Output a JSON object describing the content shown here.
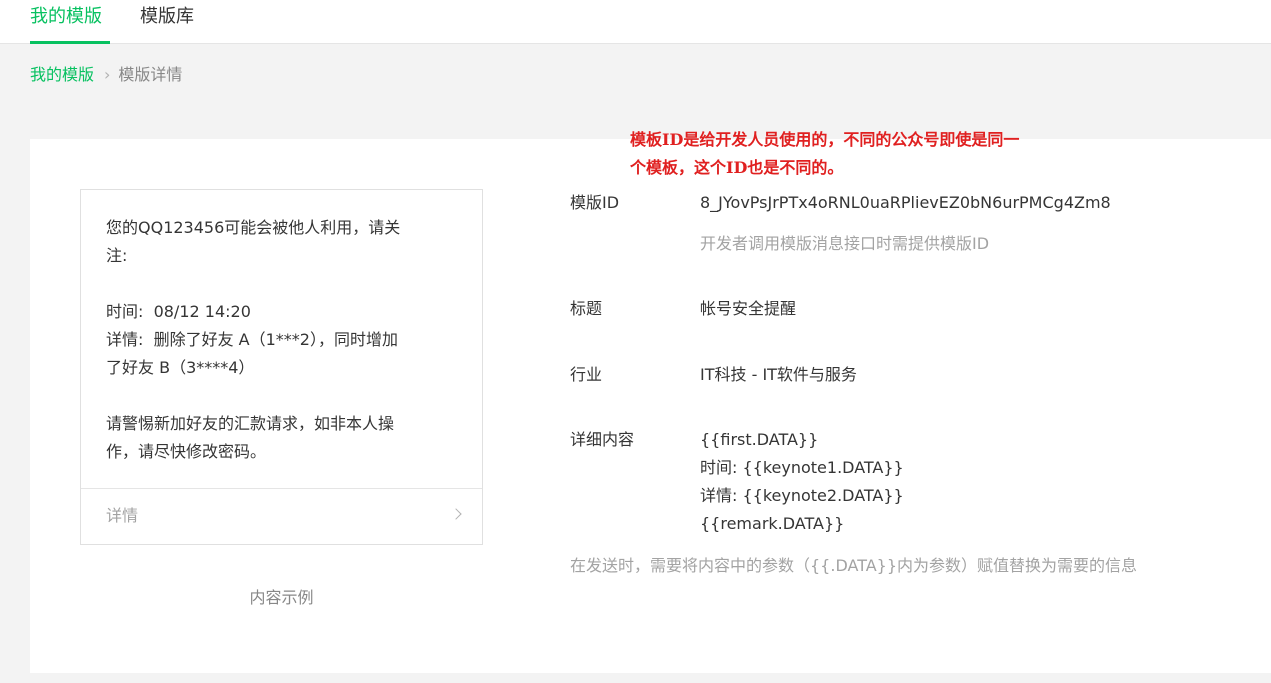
{
  "tabs": {
    "my_templates": "我的模版",
    "library": "模版库"
  },
  "breadcrumb": {
    "root": "我的模版",
    "separator": "›",
    "current": "模版详情"
  },
  "annotation": {
    "line1": "模板ID是给开发人员使用的，不同的公众号即使是同一",
    "line2": "个模板，这个ID也是不同的。"
  },
  "preview": {
    "lines": [
      "您的QQ123456可能会被他人利用，请关",
      "注:",
      "",
      "时间:  08/12 14:20",
      "详情:  删除了好友 A（1***2），同时增加",
      "了好友 B（3****4）",
      "",
      "请警惕新加好友的汇款请求，如非本人操",
      "作，请尽快修改密码。"
    ],
    "detail_label": "详情",
    "caption": "内容示例"
  },
  "fields": {
    "template_id": {
      "label": "模版ID",
      "value": "8_JYovPsJrPTx4oRNL0uaRPlievEZ0bN6urPMCg4Zm8",
      "hint": "开发者调用模版消息接口时需提供模版ID"
    },
    "title": {
      "label": "标题",
      "value": "帐号安全提醒"
    },
    "industry": {
      "label": "行业",
      "value": "IT科技 - IT软件与服务"
    },
    "content": {
      "label": "详细内容",
      "lines": [
        "{{first.DATA}}",
        "时间:  {{keynote1.DATA}}",
        "详情:  {{keynote2.DATA}}",
        "{{remark.DATA}}"
      ],
      "hint": "在发送时，需要将内容中的参数（{{.DATA}}内为参数）赋值替换为需要的信息"
    }
  },
  "colors": {
    "accent": "#07c160",
    "annotation": "#e02020",
    "muted": "#a3a3a3"
  }
}
